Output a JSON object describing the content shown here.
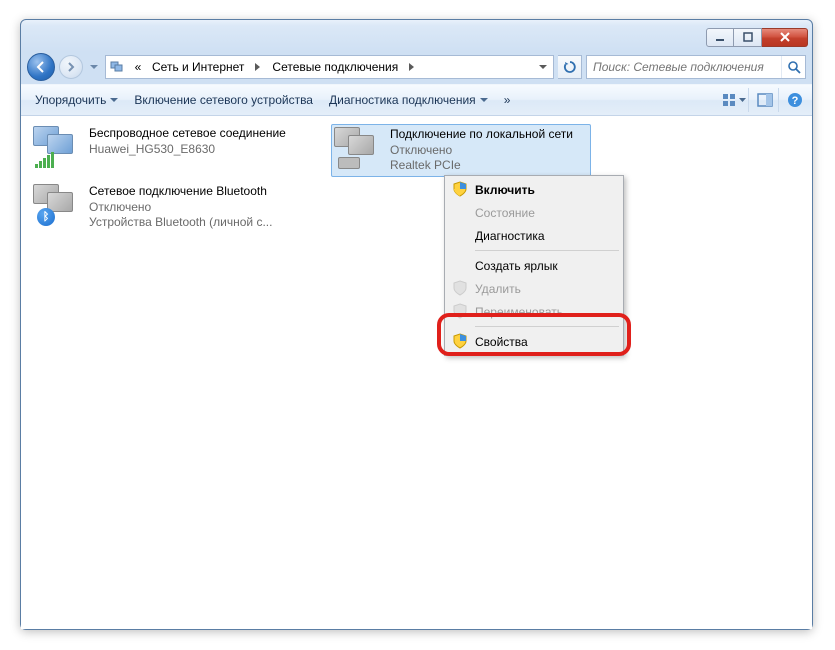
{
  "breadcrumb": {
    "back_chevrons": "«",
    "seg1": "Сеть и Интернет",
    "seg2": "Сетевые подключения"
  },
  "search": {
    "placeholder": "Поиск: Сетевые подключения"
  },
  "toolbar": {
    "organize": "Упорядочить",
    "enable_device": "Включение сетевого устройства",
    "diagnose": "Диагностика подключения"
  },
  "connections": {
    "wifi": {
      "name": "Беспроводное сетевое соединение",
      "sub": "Huawei_HG530_E8630"
    },
    "bt": {
      "name": "Сетевое подключение Bluetooth",
      "status": "Отключено",
      "sub": "Устройства Bluetooth (личной с..."
    },
    "lan": {
      "name": "Подключение по локальной сети",
      "status": "Отключено",
      "sub": "Realtek PCIe"
    }
  },
  "ctx": {
    "enable": "Включить",
    "status": "Состояние",
    "diag": "Диагностика",
    "shortcut": "Создать ярлык",
    "delete": "Удалить",
    "rename": "Переименовать",
    "props": "Свойства"
  }
}
